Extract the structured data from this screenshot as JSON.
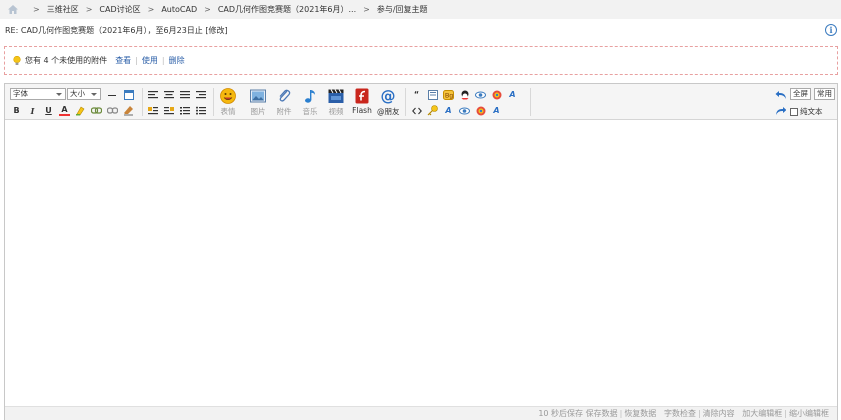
{
  "breadcrumb": {
    "items": [
      "三维社区",
      "CAD讨论区",
      "AutoCAD",
      "CAD几何作图竞赛题（2021年6月）...",
      "参与/回复主题"
    ],
    "separator": ">"
  },
  "topic": {
    "title": "RE: CAD几何作图竞赛题（2021年6月），至6月23日止",
    "edit": "[修改]"
  },
  "attachments": {
    "notice": "您有 4 个未使用的附件",
    "view": "查看",
    "use": "使用",
    "delete": "删除",
    "divider": "|"
  },
  "toolbar": {
    "font_select": "字体",
    "size_select": "大小",
    "bold": "B",
    "italic": "I",
    "underline": "U",
    "color": "A",
    "emoji_label": "表情",
    "image_label": "图片",
    "attach_label": "附件",
    "music_label": "音乐",
    "video_label": "视频",
    "flash_label": "Flash",
    "mention_label": "@朋友",
    "fullscreen": "全屏",
    "common": "常用",
    "plaintext": "纯文本"
  },
  "status": {
    "autosave": "10 秒后保存",
    "save": "保存数据",
    "restore": "恢复数据",
    "wordcount": "字数检查",
    "clear": "清除内容",
    "enlarge": "加大编辑框",
    "shrink": "缩小编辑框",
    "divider": "|"
  },
  "colors": {
    "link": "#2b5fa8",
    "dashed_border": "#e8a0a0",
    "toolbar_bg": "#f5f5f5"
  }
}
